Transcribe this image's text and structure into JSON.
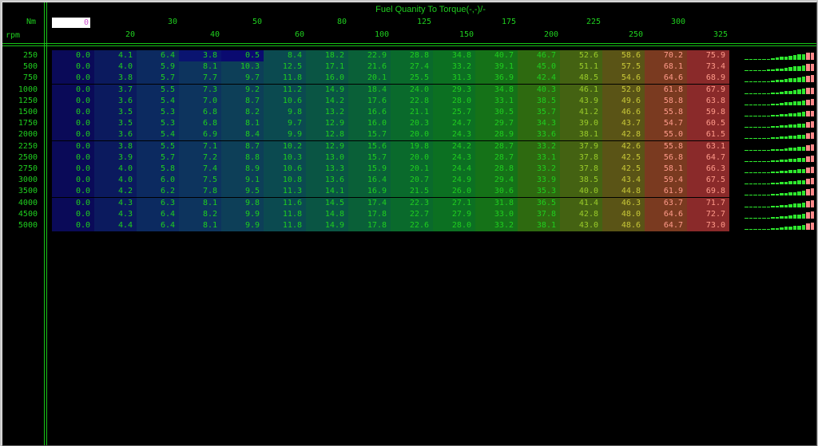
{
  "table": {
    "title": "Fuel Quanity To Torque(-,-)/-",
    "x_unit": "Nm",
    "y_unit": "rpm",
    "edit_value": "0",
    "columns_top": [
      "30",
      "50",
      "80",
      "125",
      "175",
      "225",
      "300"
    ],
    "columns_bottom": [
      "20",
      "40",
      "60",
      "100",
      "150",
      "200",
      "250",
      "325"
    ],
    "rows": [
      "250",
      "500",
      "750",
      "1000",
      "1250",
      "1500",
      "1750",
      "2000",
      "2250",
      "2500",
      "2750",
      "3000",
      "3500",
      "4000",
      "4500",
      "5000"
    ],
    "values": [
      [
        "0.0",
        "4.1",
        "6.4",
        "3.8",
        "0.5",
        "8.4",
        "18.2",
        "22.9",
        "28.8",
        "34.8",
        "40.7",
        "46.7",
        "52.6",
        "58.6",
        "70.2",
        "75.9"
      ],
      [
        "0.0",
        "4.0",
        "5.9",
        "8.1",
        "10.3",
        "12.5",
        "17.1",
        "21.6",
        "27.4",
        "33.2",
        "39.1",
        "45.0",
        "51.1",
        "57.5",
        "68.1",
        "73.4"
      ],
      [
        "0.0",
        "3.8",
        "5.7",
        "7.7",
        "9.7",
        "11.8",
        "16.0",
        "20.1",
        "25.5",
        "31.3",
        "36.9",
        "42.4",
        "48.5",
        "54.6",
        "64.6",
        "68.9"
      ],
      [
        "0.0",
        "3.7",
        "5.5",
        "7.3",
        "9.2",
        "11.2",
        "14.9",
        "18.4",
        "24.0",
        "29.3",
        "34.8",
        "40.3",
        "46.1",
        "52.0",
        "61.8",
        "67.9"
      ],
      [
        "0.0",
        "3.6",
        "5.4",
        "7.0",
        "8.7",
        "10.6",
        "14.2",
        "17.6",
        "22.8",
        "28.0",
        "33.1",
        "38.5",
        "43.9",
        "49.6",
        "58.8",
        "63.8"
      ],
      [
        "0.0",
        "3.5",
        "5.3",
        "6.8",
        "8.2",
        "9.8",
        "13.2",
        "16.6",
        "21.1",
        "25.7",
        "30.5",
        "35.7",
        "41.2",
        "46.6",
        "55.8",
        "59.8"
      ],
      [
        "0.0",
        "3.5",
        "5.3",
        "6.8",
        "8.1",
        "9.7",
        "12.9",
        "16.0",
        "20.3",
        "24.7",
        "29.7",
        "34.3",
        "39.0",
        "43.7",
        "54.7",
        "60.5"
      ],
      [
        "0.0",
        "3.6",
        "5.4",
        "6.9",
        "8.4",
        "9.9",
        "12.8",
        "15.7",
        "20.0",
        "24.3",
        "28.9",
        "33.6",
        "38.1",
        "42.8",
        "55.0",
        "61.5"
      ],
      [
        "0.0",
        "3.8",
        "5.5",
        "7.1",
        "8.7",
        "10.2",
        "12.9",
        "15.6",
        "19.8",
        "24.2",
        "28.7",
        "33.2",
        "37.9",
        "42.6",
        "55.8",
        "63.1"
      ],
      [
        "0.0",
        "3.9",
        "5.7",
        "7.2",
        "8.8",
        "10.3",
        "13.0",
        "15.7",
        "20.0",
        "24.3",
        "28.7",
        "33.1",
        "37.8",
        "42.5",
        "56.8",
        "64.7"
      ],
      [
        "0.0",
        "4.0",
        "5.8",
        "7.4",
        "8.9",
        "10.6",
        "13.3",
        "15.9",
        "20.1",
        "24.4",
        "28.8",
        "33.2",
        "37.8",
        "42.5",
        "58.1",
        "66.3"
      ],
      [
        "0.0",
        "4.0",
        "6.0",
        "7.5",
        "9.1",
        "10.8",
        "13.6",
        "16.4",
        "20.7",
        "24.9",
        "29.4",
        "33.9",
        "38.5",
        "43.4",
        "59.4",
        "67.5"
      ],
      [
        "0.0",
        "4.2",
        "6.2",
        "7.8",
        "9.5",
        "11.3",
        "14.1",
        "16.9",
        "21.5",
        "26.0",
        "30.6",
        "35.3",
        "40.0",
        "44.8",
        "61.9",
        "69.8"
      ],
      [
        "0.0",
        "4.3",
        "6.3",
        "8.1",
        "9.8",
        "11.6",
        "14.5",
        "17.4",
        "22.3",
        "27.1",
        "31.8",
        "36.5",
        "41.4",
        "46.3",
        "63.7",
        "71.7"
      ],
      [
        "0.0",
        "4.3",
        "6.4",
        "8.2",
        "9.9",
        "11.8",
        "14.8",
        "17.8",
        "22.7",
        "27.9",
        "33.0",
        "37.8",
        "42.8",
        "48.0",
        "64.6",
        "72.7"
      ],
      [
        "0.0",
        "4.4",
        "6.4",
        "8.1",
        "9.9",
        "11.8",
        "14.9",
        "17.8",
        "22.6",
        "28.0",
        "33.2",
        "38.1",
        "43.0",
        "48.6",
        "64.7",
        "73.0"
      ]
    ]
  },
  "colors": {
    "text_green": "#1fcf1f",
    "edit_text": "#d050d0",
    "column_heat": [
      "#0a0a5c",
      "#0b1a5e",
      "#0c2a60",
      "#0d345e",
      "#0d3f58",
      "#0b4a50",
      "#0a5544",
      "#0a6038",
      "#0a6a2c",
      "#0c7022",
      "#157218",
      "#2e6a10",
      "#446212",
      "#5a5416",
      "#7a3a20",
      "#8a2a2a"
    ]
  },
  "icons": {
    "sparkline": "bar-sparkline-icon"
  }
}
